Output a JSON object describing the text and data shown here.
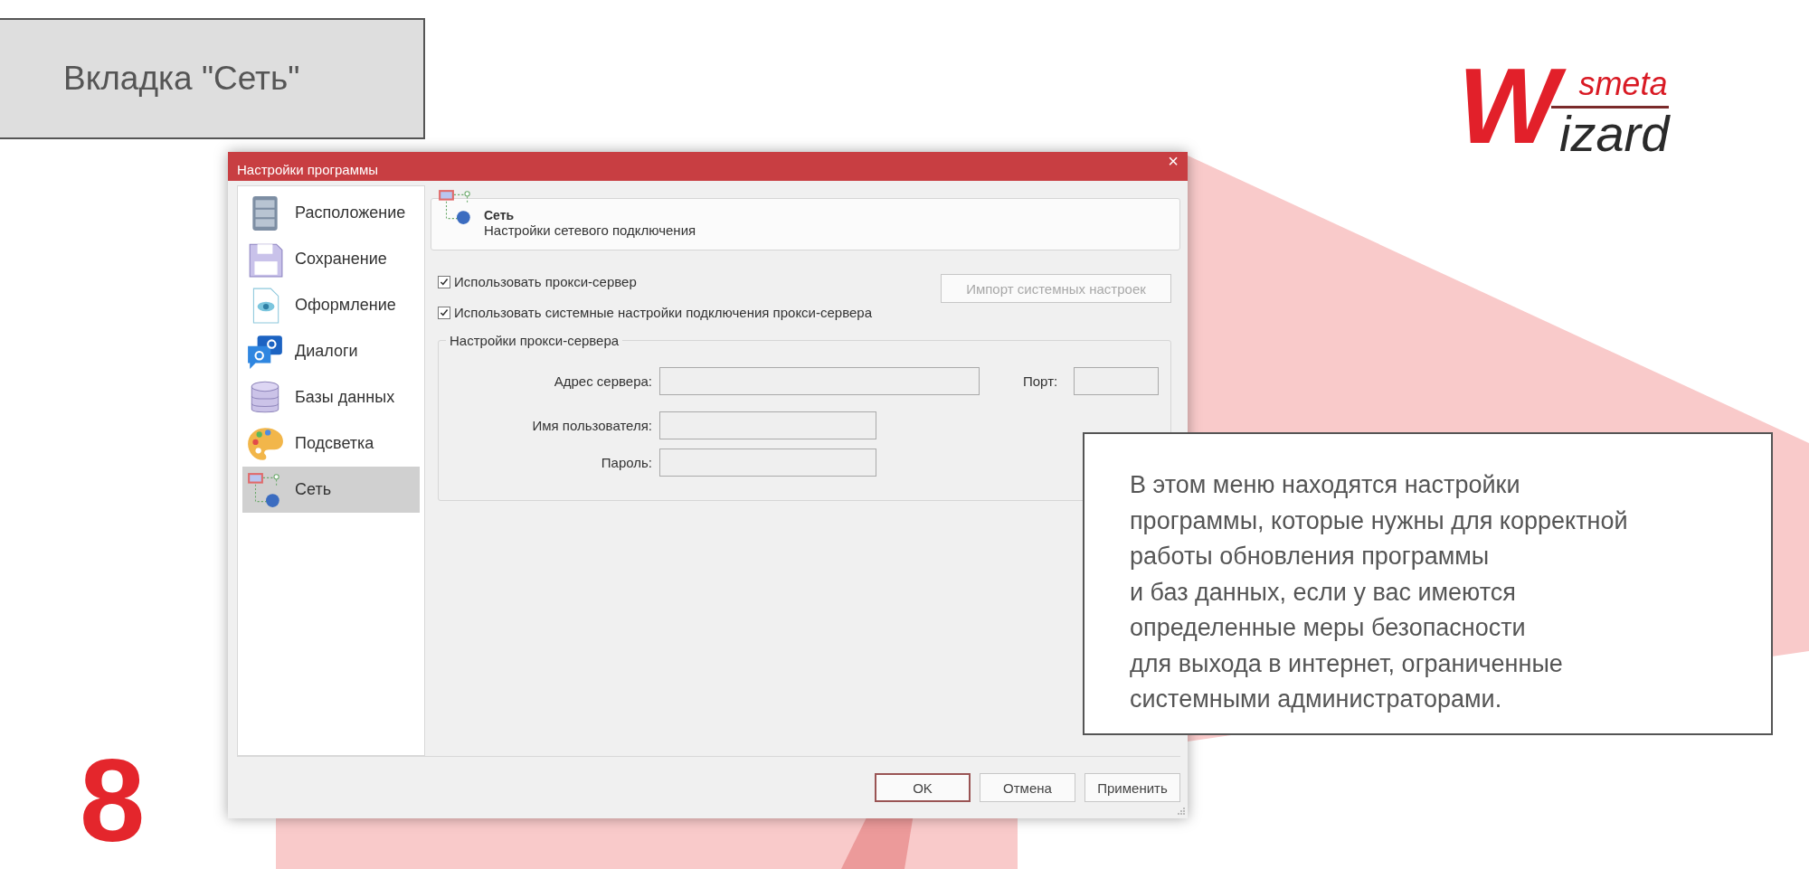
{
  "slide_title": "Вкладка \"Сеть\"",
  "logo": {
    "tagline": "smeta",
    "initial": "W",
    "word": "izard"
  },
  "dialog": {
    "title": "Настройки программы",
    "close": "×",
    "sidebar": [
      {
        "label": "Расположение",
        "kind": "cabinet",
        "selected": false
      },
      {
        "label": "Сохранение",
        "kind": "floppy",
        "selected": false
      },
      {
        "label": "Оформление",
        "kind": "document",
        "selected": false
      },
      {
        "label": "Диалоги",
        "kind": "chat",
        "selected": false
      },
      {
        "label": "Базы данных",
        "kind": "database",
        "selected": false
      },
      {
        "label": "Подсветка",
        "kind": "palette",
        "selected": false
      },
      {
        "label": "Сеть",
        "kind": "network",
        "selected": true
      }
    ],
    "header": {
      "title": "Сеть",
      "subtitle": "Настройки сетевого подключения"
    },
    "options": [
      {
        "label": "Использовать прокси-сервер",
        "checked": true
      },
      {
        "label": "Использовать системные настройки подключения прокси-сервера",
        "checked": true
      }
    ],
    "import_button": {
      "label": "Импорт системных настроек",
      "disabled": true
    },
    "proxy_group": {
      "title": "Настройки прокси-сервера",
      "address_label": "Адрес сервера:",
      "port_label": "Порт:",
      "user_label": "Имя пользователя:",
      "password_label": "Пароль:"
    },
    "buttons": [
      {
        "label": "OK",
        "default": true
      },
      {
        "label": "Отмена",
        "default": false
      },
      {
        "label": "Применить",
        "default": false
      }
    ]
  },
  "step_number": "8",
  "callout": "В этом меню находятся настройки\nпрограммы, которые нужны для корректной\nработы обновления программы\nи баз данных, если у вас имеются\nопределенные меры безопасности\nдля выхода в интернет, ограниченные\nсистемными администраторами."
}
